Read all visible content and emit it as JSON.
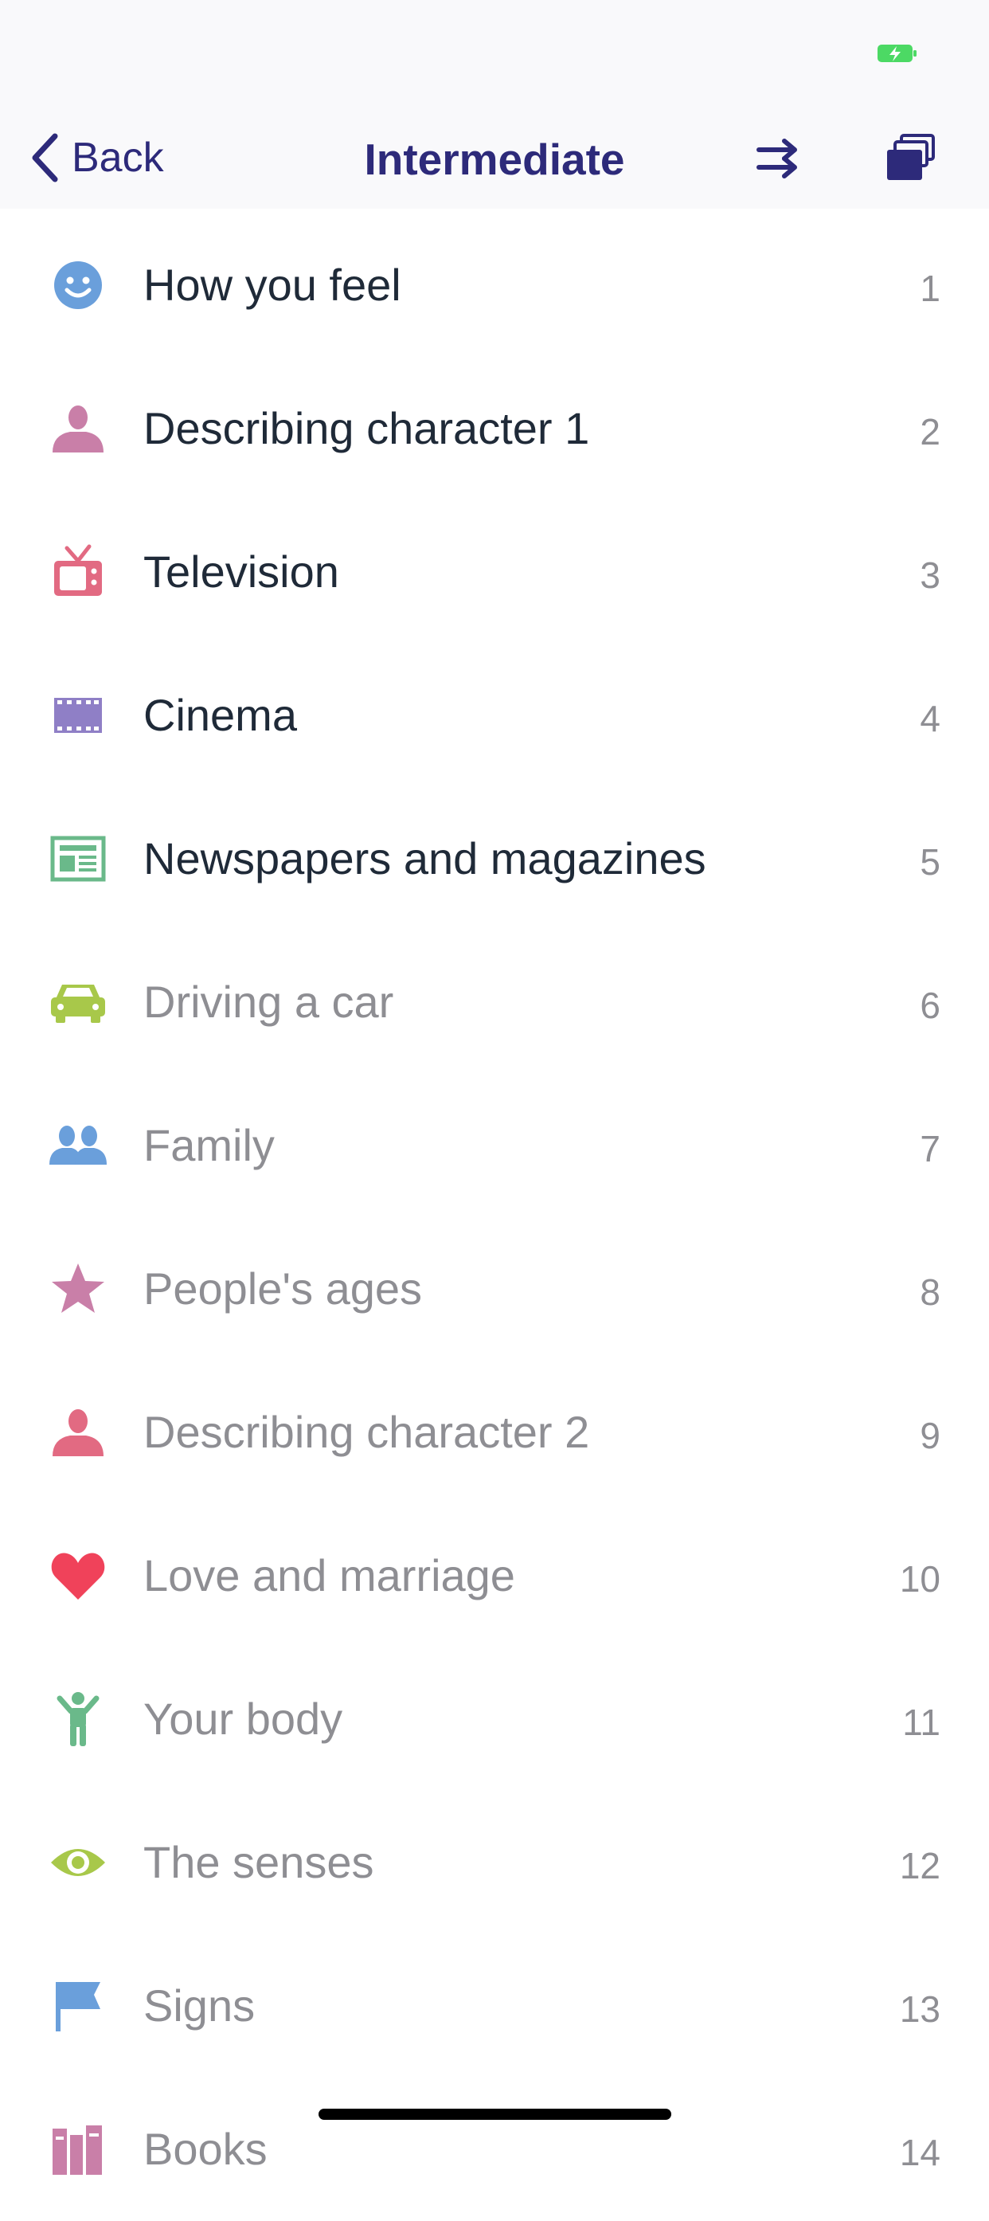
{
  "status_bar": {
    "battery_color": "#4cd964"
  },
  "nav": {
    "back_label": "Back",
    "title": "Intermediate",
    "tint_color": "#2d2a7a"
  },
  "topics": [
    {
      "title": "How you feel",
      "number": "1",
      "icon": "smiley-icon",
      "color": "#6a9fdb",
      "locked": false
    },
    {
      "title": "Describing character 1",
      "number": "2",
      "icon": "person-icon",
      "color": "#c97fa8",
      "locked": false
    },
    {
      "title": "Television",
      "number": "3",
      "icon": "television-icon",
      "color": "#e26a82",
      "locked": false
    },
    {
      "title": "Cinema",
      "number": "4",
      "icon": "film-strip-icon",
      "color": "#8f7fc6",
      "locked": false
    },
    {
      "title": "Newspapers and magazines",
      "number": "5",
      "icon": "newspaper-icon",
      "color": "#6ab98a",
      "locked": false
    },
    {
      "title": "Driving a car",
      "number": "6",
      "icon": "car-icon",
      "color": "#a8c84a",
      "locked": true
    },
    {
      "title": "Family",
      "number": "7",
      "icon": "people-icon",
      "color": "#6a9fdb",
      "locked": true
    },
    {
      "title": "People's ages",
      "number": "8",
      "icon": "star-icon",
      "color": "#c97fa8",
      "locked": true
    },
    {
      "title": "Describing character 2",
      "number": "9",
      "icon": "person-icon",
      "color": "#e26a82",
      "locked": true
    },
    {
      "title": "Love and marriage",
      "number": "10",
      "icon": "heart-icon",
      "color": "#f0425a",
      "locked": true
    },
    {
      "title": "Your body",
      "number": "11",
      "icon": "body-icon",
      "color": "#6ab98a",
      "locked": true
    },
    {
      "title": "The senses",
      "number": "12",
      "icon": "eye-icon",
      "color": "#a8c84a",
      "locked": true
    },
    {
      "title": "Signs",
      "number": "13",
      "icon": "flag-icon",
      "color": "#6a9fdb",
      "locked": true
    },
    {
      "title": "Books",
      "number": "14",
      "icon": "books-icon",
      "color": "#c97fa8",
      "locked": true
    }
  ]
}
